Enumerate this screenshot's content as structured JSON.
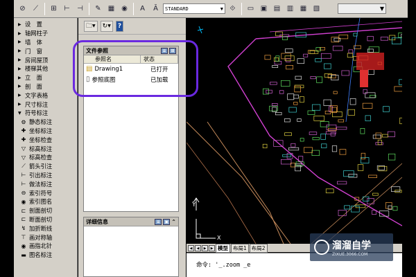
{
  "toolbar": {
    "text_style": "STANDARD",
    "icons": [
      "no-entry-icon",
      "dimension-icon",
      "axis-icon",
      "grid-icon",
      "column-icon",
      "snap-icon",
      "grid-icon",
      "target-icon",
      "text-a-icon",
      "text-a2-icon",
      "window-icon",
      "tile-icon",
      "tile2-icon",
      "tile3-icon",
      "tile4-icon",
      "tile5-icon"
    ]
  },
  "left_menu": {
    "items": [
      {
        "label": "设　置",
        "arrow": "▶"
      },
      {
        "label": "轴网柱子",
        "arrow": "▶"
      },
      {
        "label": "墙　体",
        "arrow": "▶"
      },
      {
        "label": "门　窗",
        "arrow": "▶"
      },
      {
        "label": "房间屋顶",
        "arrow": "▶"
      },
      {
        "label": "楼梯其他",
        "arrow": "▶"
      },
      {
        "label": "立　面",
        "arrow": "▶"
      },
      {
        "label": "剖　面",
        "arrow": "▶"
      },
      {
        "label": "文字表格",
        "arrow": "▶"
      },
      {
        "label": "尺寸标注",
        "arrow": "▶"
      },
      {
        "label": "符号标注",
        "arrow": "▼"
      }
    ],
    "sub_items": [
      {
        "label": "静态标注",
        "icon": "⚙"
      },
      {
        "label": "坐标标注",
        "icon": "✚"
      },
      {
        "label": "坐标检查",
        "icon": "✚"
      },
      {
        "label": "标高标注",
        "icon": "▽"
      },
      {
        "label": "标高检查",
        "icon": "▽"
      },
      {
        "label": "箭头引注",
        "icon": "⟋"
      },
      {
        "label": "引出标注",
        "icon": "⊢"
      },
      {
        "label": "做法标注",
        "icon": "⊢"
      },
      {
        "label": "索引符号",
        "icon": "⊖"
      },
      {
        "label": "索引图名",
        "icon": "◉"
      },
      {
        "label": "剖面剖切",
        "icon": "⊏"
      },
      {
        "label": "断面剖切",
        "icon": "⊏"
      },
      {
        "label": "加折断线",
        "icon": "↯"
      },
      {
        "label": "画对称轴",
        "icon": "⊤"
      },
      {
        "label": "画指北针",
        "icon": "◉"
      },
      {
        "label": "图名标注",
        "icon": "▬"
      }
    ]
  },
  "xref_panel": {
    "title": "文件参照",
    "columns": [
      "参照名",
      "状态"
    ],
    "rows": [
      {
        "name": "Drawing1",
        "status": "已打开"
      },
      {
        "name": "参照底图",
        "status": "已加载"
      }
    ],
    "detail_title": "详细信息"
  },
  "layout_tabs": [
    "模型",
    "布局1",
    "布局2"
  ],
  "command_line": "命令: '_.zoom _e",
  "watermark": {
    "name": "溜溜自学",
    "url": "ZIXUE.3066.COM"
  },
  "colors": {
    "highlight": "#6a29e0",
    "panel_bg": "#d4d0c8",
    "canvas_bg": "#000000"
  }
}
